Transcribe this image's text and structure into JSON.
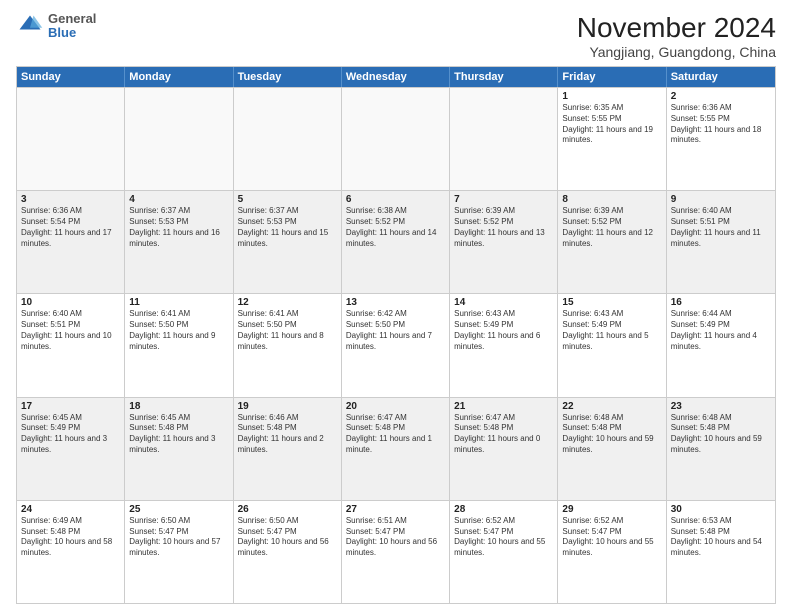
{
  "logo": {
    "general": "General",
    "blue": "Blue"
  },
  "title": "November 2024",
  "subtitle": "Yangjiang, Guangdong, China",
  "days_of_week": [
    "Sunday",
    "Monday",
    "Tuesday",
    "Wednesday",
    "Thursday",
    "Friday",
    "Saturday"
  ],
  "weeks": [
    [
      {
        "day": "",
        "info": ""
      },
      {
        "day": "",
        "info": ""
      },
      {
        "day": "",
        "info": ""
      },
      {
        "day": "",
        "info": ""
      },
      {
        "day": "",
        "info": ""
      },
      {
        "day": "1",
        "info": "Sunrise: 6:35 AM\nSunset: 5:55 PM\nDaylight: 11 hours and 19 minutes."
      },
      {
        "day": "2",
        "info": "Sunrise: 6:36 AM\nSunset: 5:55 PM\nDaylight: 11 hours and 18 minutes."
      }
    ],
    [
      {
        "day": "3",
        "info": "Sunrise: 6:36 AM\nSunset: 5:54 PM\nDaylight: 11 hours and 17 minutes."
      },
      {
        "day": "4",
        "info": "Sunrise: 6:37 AM\nSunset: 5:53 PM\nDaylight: 11 hours and 16 minutes."
      },
      {
        "day": "5",
        "info": "Sunrise: 6:37 AM\nSunset: 5:53 PM\nDaylight: 11 hours and 15 minutes."
      },
      {
        "day": "6",
        "info": "Sunrise: 6:38 AM\nSunset: 5:52 PM\nDaylight: 11 hours and 14 minutes."
      },
      {
        "day": "7",
        "info": "Sunrise: 6:39 AM\nSunset: 5:52 PM\nDaylight: 11 hours and 13 minutes."
      },
      {
        "day": "8",
        "info": "Sunrise: 6:39 AM\nSunset: 5:52 PM\nDaylight: 11 hours and 12 minutes."
      },
      {
        "day": "9",
        "info": "Sunrise: 6:40 AM\nSunset: 5:51 PM\nDaylight: 11 hours and 11 minutes."
      }
    ],
    [
      {
        "day": "10",
        "info": "Sunrise: 6:40 AM\nSunset: 5:51 PM\nDaylight: 11 hours and 10 minutes."
      },
      {
        "day": "11",
        "info": "Sunrise: 6:41 AM\nSunset: 5:50 PM\nDaylight: 11 hours and 9 minutes."
      },
      {
        "day": "12",
        "info": "Sunrise: 6:41 AM\nSunset: 5:50 PM\nDaylight: 11 hours and 8 minutes."
      },
      {
        "day": "13",
        "info": "Sunrise: 6:42 AM\nSunset: 5:50 PM\nDaylight: 11 hours and 7 minutes."
      },
      {
        "day": "14",
        "info": "Sunrise: 6:43 AM\nSunset: 5:49 PM\nDaylight: 11 hours and 6 minutes."
      },
      {
        "day": "15",
        "info": "Sunrise: 6:43 AM\nSunset: 5:49 PM\nDaylight: 11 hours and 5 minutes."
      },
      {
        "day": "16",
        "info": "Sunrise: 6:44 AM\nSunset: 5:49 PM\nDaylight: 11 hours and 4 minutes."
      }
    ],
    [
      {
        "day": "17",
        "info": "Sunrise: 6:45 AM\nSunset: 5:49 PM\nDaylight: 11 hours and 3 minutes."
      },
      {
        "day": "18",
        "info": "Sunrise: 6:45 AM\nSunset: 5:48 PM\nDaylight: 11 hours and 3 minutes."
      },
      {
        "day": "19",
        "info": "Sunrise: 6:46 AM\nSunset: 5:48 PM\nDaylight: 11 hours and 2 minutes."
      },
      {
        "day": "20",
        "info": "Sunrise: 6:47 AM\nSunset: 5:48 PM\nDaylight: 11 hours and 1 minute."
      },
      {
        "day": "21",
        "info": "Sunrise: 6:47 AM\nSunset: 5:48 PM\nDaylight: 11 hours and 0 minutes."
      },
      {
        "day": "22",
        "info": "Sunrise: 6:48 AM\nSunset: 5:48 PM\nDaylight: 10 hours and 59 minutes."
      },
      {
        "day": "23",
        "info": "Sunrise: 6:48 AM\nSunset: 5:48 PM\nDaylight: 10 hours and 59 minutes."
      }
    ],
    [
      {
        "day": "24",
        "info": "Sunrise: 6:49 AM\nSunset: 5:48 PM\nDaylight: 10 hours and 58 minutes."
      },
      {
        "day": "25",
        "info": "Sunrise: 6:50 AM\nSunset: 5:47 PM\nDaylight: 10 hours and 57 minutes."
      },
      {
        "day": "26",
        "info": "Sunrise: 6:50 AM\nSunset: 5:47 PM\nDaylight: 10 hours and 56 minutes."
      },
      {
        "day": "27",
        "info": "Sunrise: 6:51 AM\nSunset: 5:47 PM\nDaylight: 10 hours and 56 minutes."
      },
      {
        "day": "28",
        "info": "Sunrise: 6:52 AM\nSunset: 5:47 PM\nDaylight: 10 hours and 55 minutes."
      },
      {
        "day": "29",
        "info": "Sunrise: 6:52 AM\nSunset: 5:47 PM\nDaylight: 10 hours and 55 minutes."
      },
      {
        "day": "30",
        "info": "Sunrise: 6:53 AM\nSunset: 5:48 PM\nDaylight: 10 hours and 54 minutes."
      }
    ]
  ]
}
